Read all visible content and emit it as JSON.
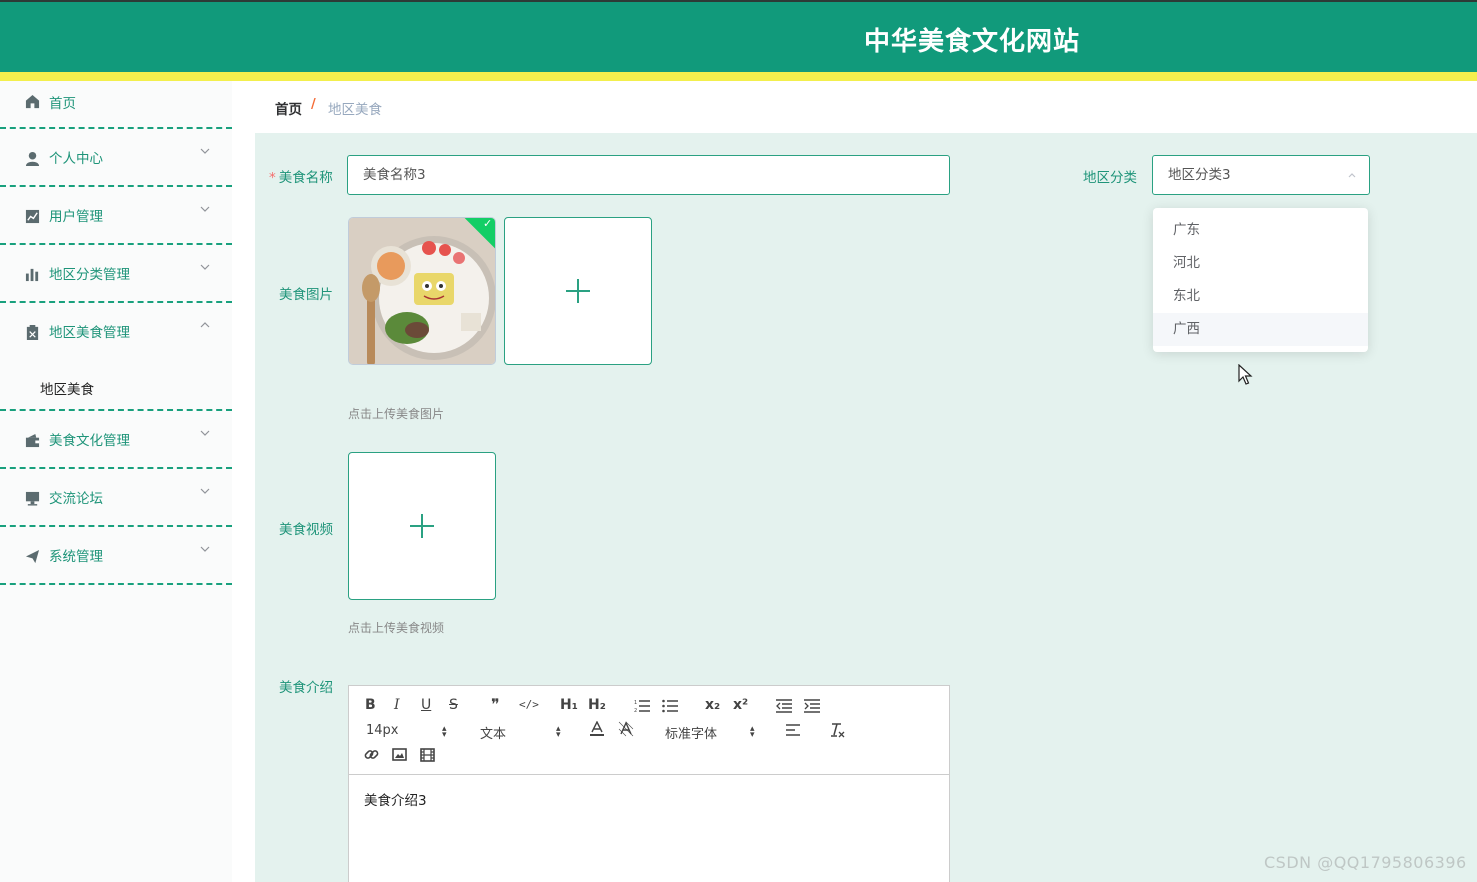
{
  "header": {
    "title": "中华美食文化网站"
  },
  "sidebar": {
    "items": [
      {
        "label": "首页",
        "icon": "home-icon"
      },
      {
        "label": "个人中心",
        "icon": "user-icon"
      },
      {
        "label": "用户管理",
        "icon": "chart-icon"
      },
      {
        "label": "地区分类管理",
        "icon": "bar-chart-icon"
      },
      {
        "label": "地区美食管理",
        "icon": "clipboard-icon"
      },
      {
        "label": "美食文化管理",
        "icon": "wallet-icon"
      },
      {
        "label": "交流论坛",
        "icon": "monitor-icon"
      },
      {
        "label": "系统管理",
        "icon": "send-icon"
      }
    ],
    "submenu_label": "地区美食"
  },
  "breadcrumb": {
    "home": "首页",
    "separator": "/",
    "current": "地区美食"
  },
  "form": {
    "name_label": "美食名称",
    "name_required": "*",
    "name_value": "美食名称3",
    "category_label": "地区分类",
    "category_value": "地区分类3",
    "category_options": [
      "广东",
      "河北",
      "东北",
      "广西"
    ],
    "image_label": "美食图片",
    "image_tip": "点击上传美食图片",
    "video_label": "美食视频",
    "video_tip": "点击上传美食视频",
    "intro_label": "美食介绍",
    "intro_value": "美食介绍3"
  },
  "editor_toolbar": {
    "bold": "B",
    "italic": "I",
    "underline": "U",
    "strike": "S",
    "quote": "❞",
    "code": "</>",
    "h1": "H₁",
    "h2": "H₂",
    "subscript": "x₂",
    "superscript": "x²",
    "size_value": "14px",
    "header_value": "文本",
    "font_value": "标准字体"
  },
  "watermark": "CSDN @QQ1795806396",
  "colors": {
    "primary": "#119a7b",
    "accent_bar": "#f3ef4d",
    "content_bg": "#e4f2ee"
  }
}
